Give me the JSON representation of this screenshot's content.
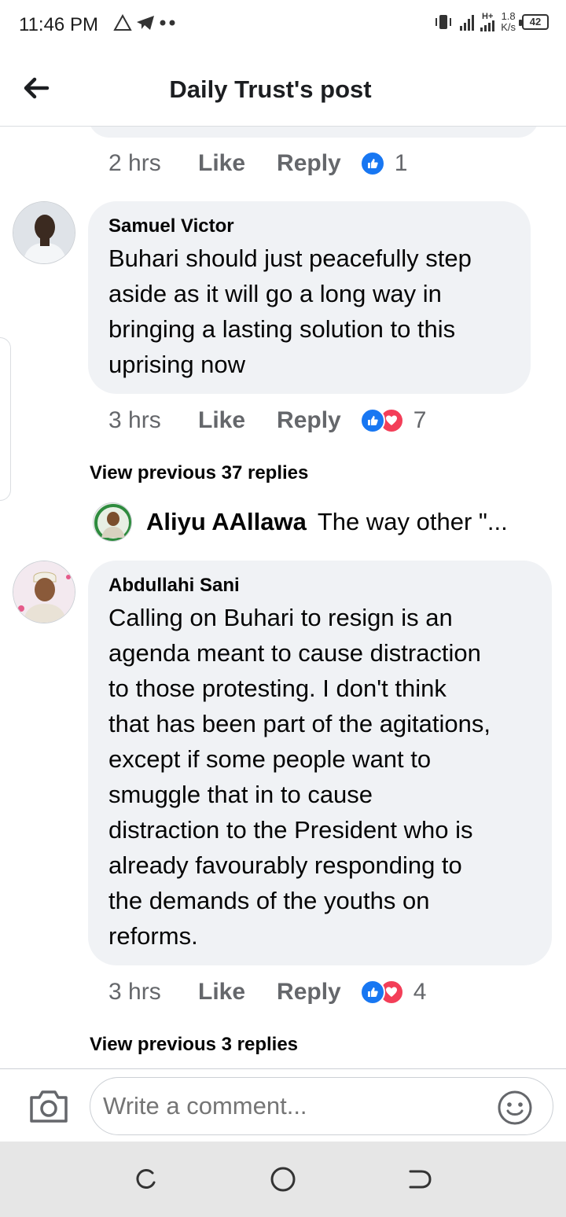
{
  "status_bar": {
    "time": "11:46 PM",
    "net_speed_value": "1.8",
    "net_speed_unit": "K/s",
    "battery": "42",
    "network_type": "H+"
  },
  "header": {
    "title": "Daily Trust's post"
  },
  "comments": [
    {
      "meta": {
        "time": "2 hrs",
        "like_label": "Like",
        "reply_label": "Reply",
        "reaction_count": "1",
        "reactions": [
          "like"
        ]
      }
    },
    {
      "author": "Samuel Victor",
      "text_lines": [
        "Buhari should just peacefully step",
        "aside as it will go a long way in",
        "bringing a lasting solution to this",
        "uprising now"
      ],
      "meta": {
        "time": "3 hrs",
        "like_label": "Like",
        "reply_label": "Reply",
        "reaction_count": "7",
        "reactions": [
          "like",
          "love"
        ]
      },
      "view_previous": "View previous 37 replies",
      "reply_preview": {
        "name": "Aliyu AAllawa",
        "text": "The way other \"..."
      }
    },
    {
      "author": "Abdullahi Sani",
      "text_lines": [
        "Calling on Buhari to resign is an",
        "agenda meant to cause distraction",
        "to those protesting. I don't think",
        "that has been part of the agitations,",
        "except if some people want to",
        "smuggle that in to cause",
        "distraction to the President who is",
        "already favourably responding to",
        "the demands of the youths on",
        "reforms."
      ],
      "meta": {
        "time": "3 hrs",
        "like_label": "Like",
        "reply_label": "Reply",
        "reaction_count": "4",
        "reactions": [
          "like",
          "love"
        ]
      },
      "view_previous": "View previous 3 replies"
    }
  ],
  "composer": {
    "placeholder": "Write a comment..."
  },
  "colors": {
    "like_blue": "#1877f2",
    "love_red": "#f33e58",
    "bubble_bg": "#f0f2f5",
    "meta_gray": "#65676b"
  },
  "icons": {
    "back": "arrow-left-icon",
    "camera": "camera-icon",
    "emoji": "smiley-icon",
    "nav_recent": "recent-apps-icon",
    "nav_home": "home-icon",
    "nav_back": "back-icon"
  }
}
